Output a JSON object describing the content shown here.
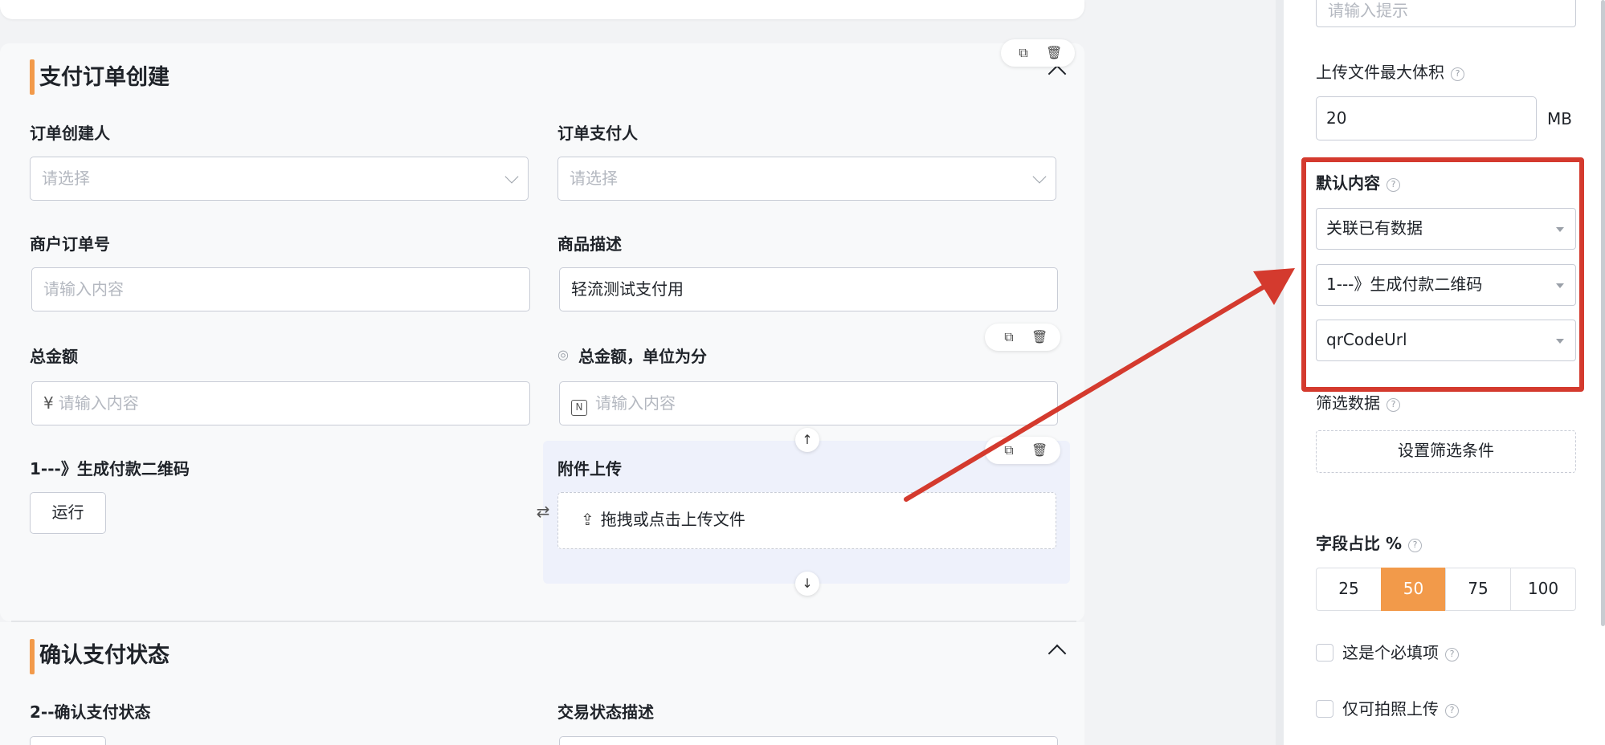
{
  "form": {
    "section1": {
      "title": "支付订单创建",
      "fields": {
        "creator_label": "订单创建人",
        "creator_placeholder": "请选择",
        "payer_label": "订单支付人",
        "payer_placeholder": "请选择",
        "merchant_order_label": "商户订单号",
        "merchant_order_placeholder": "请输入内容",
        "product_desc_label": "商品描述",
        "product_desc_value": "轻流测试支付用",
        "total_label": "总金额",
        "total_prefix": "¥",
        "total_placeholder": "请输入内容",
        "total_cents_label": "总金额，单位为分",
        "total_cents_placeholder": "请输入内容",
        "qr_label": "1---》生成付款二维码",
        "run_button": "运行",
        "attach_label": "附件上传",
        "upload_text": "拖拽或点击上传文件"
      }
    },
    "section2": {
      "title": "确认支付状态",
      "left_label": "2--确认支付状态",
      "right_label": "交易状态描述"
    }
  },
  "panel": {
    "hint_placeholder": "请输入提示",
    "max_size_label": "上传文件最大体积",
    "max_size_value": "20",
    "max_size_unit": "MB",
    "default_label": "默认内容",
    "default_source": "关联已有数据",
    "default_field": "1---》生成付款二维码",
    "default_attr": "qrCodeUrl",
    "filter_label": "筛选数据",
    "filter_button": "设置筛选条件",
    "ratio_label": "字段占比 %",
    "ratio_options": [
      "25",
      "50",
      "75",
      "100"
    ],
    "ratio_selected": "50",
    "required_label": "这是个必填项",
    "camera_only_label": "仅可拍照上传"
  },
  "colors": {
    "accent": "#f29a4a",
    "annotation": "#d43a2e"
  }
}
